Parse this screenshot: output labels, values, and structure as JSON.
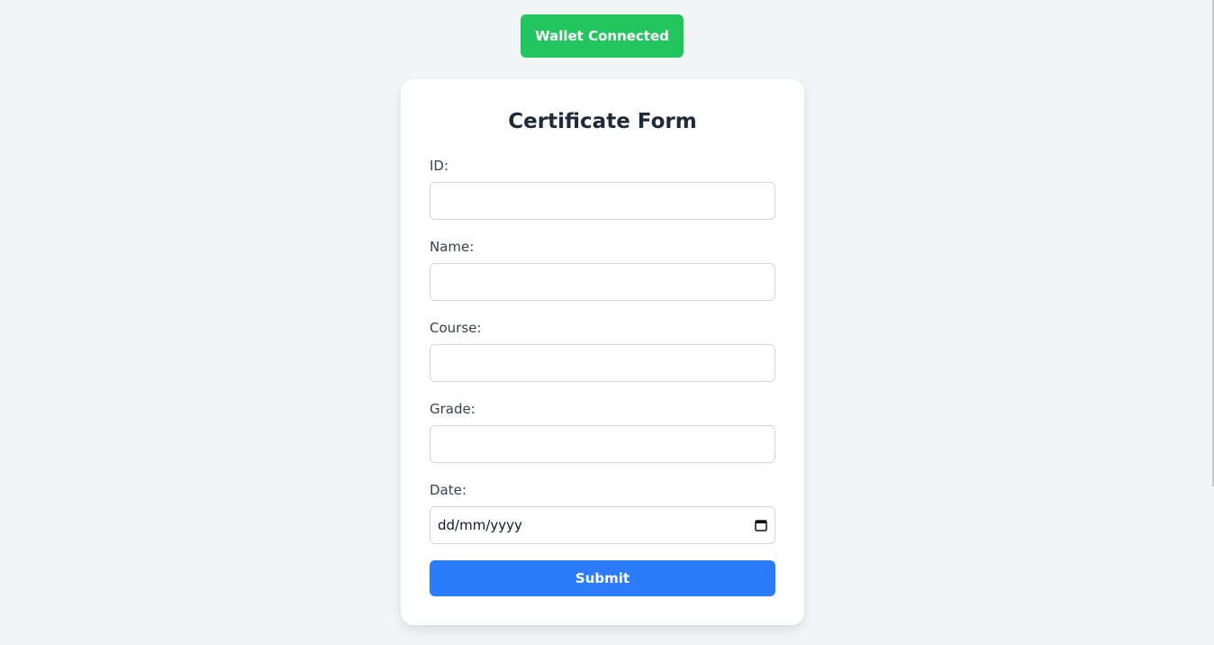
{
  "header": {
    "wallet_button_label": "Wallet Connected"
  },
  "form": {
    "title": "Certificate Form",
    "fields": [
      {
        "label": "ID:",
        "value": ""
      },
      {
        "label": "Name:",
        "value": ""
      },
      {
        "label": "Course:",
        "value": ""
      },
      {
        "label": "Grade:",
        "value": ""
      },
      {
        "label": "Date:",
        "value": "dd/mm/yyyy",
        "icon": "calendar-icon"
      }
    ],
    "submit_label": "Submit"
  },
  "colors": {
    "wallet_button": "#22c55e",
    "submit_button": "#2b7bfa",
    "background": "#f3f4f6"
  }
}
